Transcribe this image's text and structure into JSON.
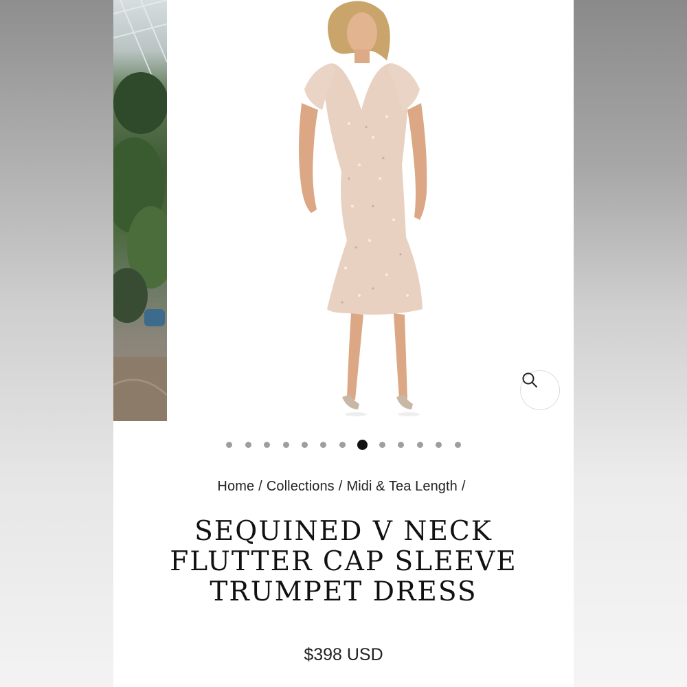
{
  "colors": {
    "page_bg": "#ffffff",
    "text": "#111111",
    "dot_inactive": "#9e9e9e",
    "dot_active": "#111111",
    "dress": "#e7cdbd"
  },
  "gallery": {
    "zoom_icon": "search-icon",
    "total_images": 13,
    "active_index": 7
  },
  "breadcrumb": {
    "items": [
      "Home",
      "Collections",
      "Midi & Tea Length"
    ],
    "separator": "/"
  },
  "product": {
    "title_lines": [
      "SEQUINED V NECK",
      "FLUTTER CAP SLEEVE",
      "TRUMPET DRESS"
    ],
    "price": "$398 USD"
  }
}
